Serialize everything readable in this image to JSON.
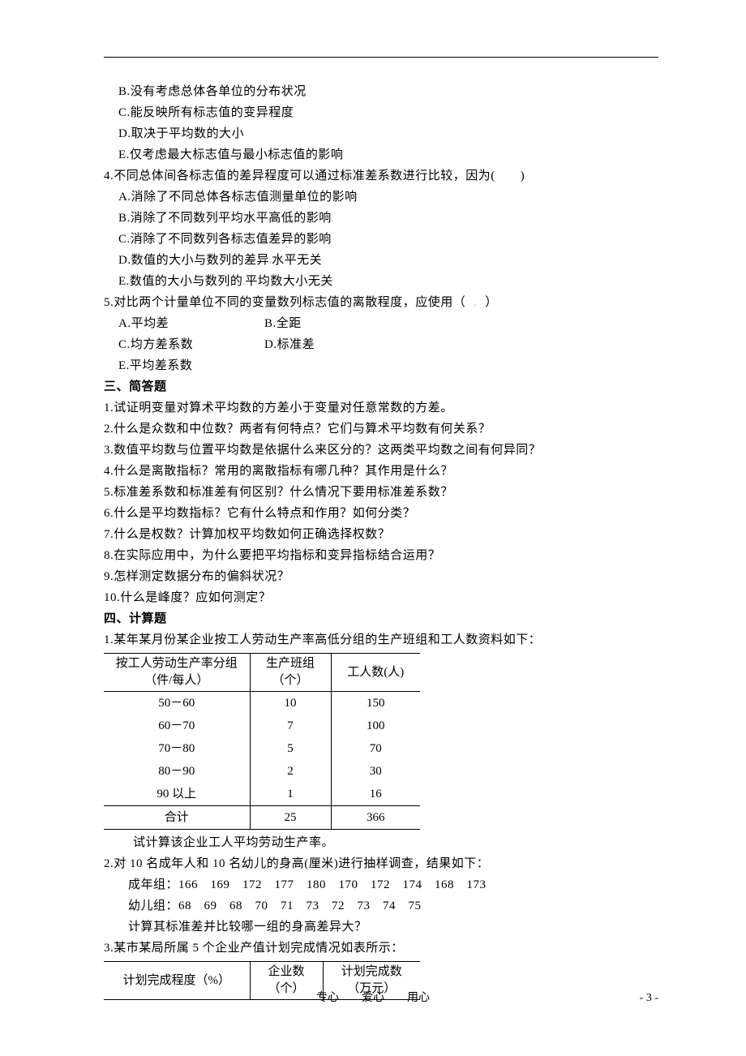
{
  "options": {
    "b": "B.没有考虑总体各单位的分布状况",
    "c": "C.能反映所有标志值的变异程度",
    "d": "D.取决于平均数的大小",
    "e": "E.仅考虑最大标志值与最小标志值的影响"
  },
  "q4": {
    "stem": "4.不同总体间各标志值的差异程度可以通过标准差系数进行比较，因为(　　)",
    "a": "A.消除了不同总体各标志值测量单位的影响",
    "b": "B.消除了不同数列平均水平高低的影响",
    "c": "C.消除了不同数列各标志值差异的影响",
    "d": "D.数值的大小与数列的差异水平无关",
    "e": "E.数值的大小与数列的平均数大小无关"
  },
  "q5": {
    "stem": "5.对比两个计量单位不同的变量数列标志值的离散程度，应使用（　　）",
    "a": "A.平均差",
    "b": "B.全距",
    "c": "C.均方差系数",
    "d": "D.标准差",
    "e": "E.平均差系数"
  },
  "section3": {
    "title": "三、简答题",
    "items": [
      "1.试证明变量对算术平均数的方差小于变量对任意常数的方差。",
      "2.什么是众数和中位数？两者有何特点？它们与算术平均数有何关系？",
      "3.数值平均数与位置平均数是依据什么来区分的？这两类平均数之间有何异同？",
      "4.什么是离散指标？常用的离散指标有哪几种？其作用是什么？",
      "5.标准差系数和标准差有何区别？什么情况下要用标准差系数？",
      "6.什么是平均数指标？它有什么特点和作用？如何分类？",
      "7.什么是权数？计算加权平均数如何正确选择权数？",
      "8.在实际应用中，为什么要把平均指标和变异指标结合运用？",
      "9.怎样测定数据分布的偏斜状况？",
      "10.什么是峰度？应如何测定？"
    ]
  },
  "section4": {
    "title": "四、计算题",
    "q1": {
      "stem": "1.某年某月份某企业按工人劳动生产率高低分组的生产班组和工人数资料如下：",
      "headers": {
        "c1a": "按工人劳动生产率分组",
        "c1b": "（件/每人）",
        "c2a": "生产班组",
        "c2b": "（个）",
        "c3": "工人数(人)"
      },
      "rows": [
        {
          "c1": "50－60",
          "c2": "10",
          "c3": "150"
        },
        {
          "c1": "60－70",
          "c2": "7",
          "c3": "100"
        },
        {
          "c1": "70－80",
          "c2": "5",
          "c3": "70"
        },
        {
          "c1": "80－90",
          "c2": "2",
          "c3": "30"
        },
        {
          "c1": "90 以上",
          "c2": "1",
          "c3": "16"
        }
      ],
      "total": {
        "c1": "合计",
        "c2": "25",
        "c3": "366"
      },
      "tail": "试计算该企业工人平均劳动生产率。"
    },
    "q2": {
      "stem": "2.对 10 名成年人和 10 名幼儿的身高(厘米)进行抽样调查，结果如下：",
      "adult": "成年组：166　169　172　177　180　170　172　174　168　173",
      "child": "幼儿组：68　69　68　70　71　73　72　73　74　75",
      "task": "计算其标准差并比较哪一组的身高差异大？"
    },
    "q3": {
      "stem": "3.某市某局所属 5 个企业产值计划完成情况如表所示：",
      "headers": {
        "c1": "计划完成程度（%）",
        "c2a": "企业数",
        "c2b": "（个）",
        "c3a": "计划完成数",
        "c3b": "（万元）"
      }
    }
  },
  "footer": {
    "motto": "专心　　爱心　　用心",
    "page": "- 3 -"
  }
}
